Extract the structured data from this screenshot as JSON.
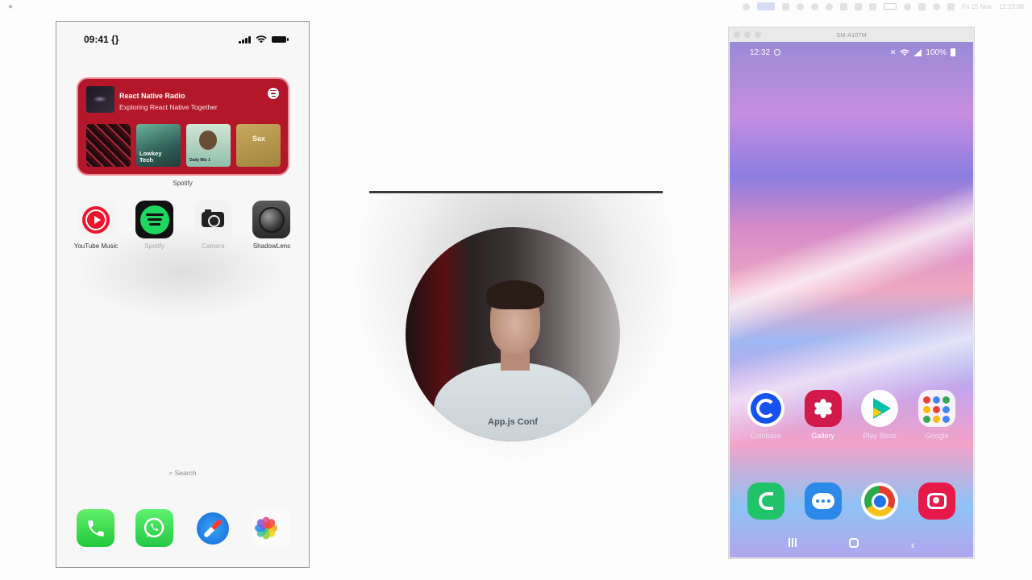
{
  "menubar": {
    "apple": "",
    "date_text": "Fri 15 Nov",
    "time_text": "12:23:08"
  },
  "iphone": {
    "status_time": "09:41 {}",
    "widget": {
      "title": "React Native Radio",
      "subtitle": "Exploring React Native Together",
      "tiles": [
        {
          "label": ""
        },
        {
          "label": "Lowkey Tech"
        },
        {
          "label": "Daily Mix 1"
        },
        {
          "label": "Sax"
        }
      ],
      "caption": "Spotify"
    },
    "apps": [
      {
        "label": "YouTube Music",
        "icon": "youtube-music-icon"
      },
      {
        "label": "Spotify",
        "icon": "spotify-icon"
      },
      {
        "label": "Camera",
        "icon": "camera-icon"
      },
      {
        "label": "ShadowLens",
        "icon": "shadowlens-icon"
      }
    ],
    "search_label": "Search",
    "dock": [
      {
        "icon": "phone-icon"
      },
      {
        "icon": "whatsapp-icon"
      },
      {
        "icon": "safari-icon"
      },
      {
        "icon": "photos-icon"
      }
    ]
  },
  "webcam": {
    "shirt_text": "App.js Conf"
  },
  "android": {
    "window_title": "SM-A107M",
    "status_time": "12:32",
    "battery": "100%",
    "home_row": [
      {
        "label": "Coinbase",
        "icon": "coinbase-icon"
      },
      {
        "label": "Gallery",
        "icon": "gallery-icon"
      },
      {
        "label": "Play Store",
        "icon": "play-store-icon"
      },
      {
        "label": "Google",
        "icon": "google-folder-icon"
      }
    ],
    "dock_row": [
      {
        "icon": "phone-icon"
      },
      {
        "icon": "messages-icon"
      },
      {
        "icon": "chrome-icon"
      },
      {
        "icon": "camera-icon"
      }
    ],
    "nav": {
      "back_glyph": "‹"
    }
  },
  "colors": {
    "spotify_widget": "#b4172a",
    "spotify_green": "#1ed760",
    "coinbase_blue": "#1652f0"
  }
}
